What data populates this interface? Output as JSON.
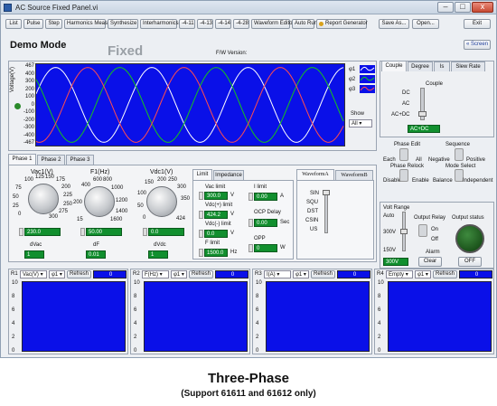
{
  "window": {
    "title": "AC Source Fixed Panel.vi",
    "min": "–",
    "max": "□",
    "close": "x"
  },
  "toolbar": {
    "items": [
      "List",
      "Pulse",
      "Step",
      "Harmonics Meas.",
      "Synthesize",
      "Interharmonics",
      "-4-11",
      "-4-13",
      "-4-14",
      "-4-28",
      "Waveform Editor",
      "Auto Run",
      "Report Generator"
    ],
    "save": "Save As...",
    "open": "Open...",
    "exit": "Exit"
  },
  "header": {
    "mode": "Demo Mode",
    "fixed": "Fixed",
    "fw": "F/W Version:",
    "screen": "Screen"
  },
  "graph": {
    "ylabel": "Voltage(V)",
    "yticks": [
      "467",
      "400",
      "300",
      "200",
      "100",
      "0",
      "-100",
      "-200",
      "-300",
      "-400",
      "-467"
    ],
    "phases": [
      "φ1",
      "φ2",
      "φ3"
    ],
    "show": "Show",
    "show_value": "All"
  },
  "coupling": {
    "tabs": [
      "Couple",
      "Degree",
      "Is",
      "Slew Rate"
    ],
    "title": "Couple",
    "opts": [
      "DC",
      "AC",
      "AC+DC"
    ],
    "value": "AC+DC"
  },
  "phase": {
    "edit": "Phase Edit",
    "each": "Each",
    "all": "All",
    "seq": "Sequence",
    "neg": "Negative",
    "pos": "Positive",
    "relock": "Phase Relock",
    "disable": "Disable",
    "enable": "Enable",
    "modesel": "Mode Select",
    "balance": "Balance",
    "indep": "Independent"
  },
  "phasetabs": [
    "Phase 1",
    "Phase 2",
    "Phase 3"
  ],
  "vac": {
    "label": "Vac1(V)",
    "ticks": [
      "100",
      "125",
      "150",
      "175",
      "200",
      "225",
      "250",
      "275",
      "300",
      "0",
      "25",
      "50",
      "75"
    ],
    "value": "230.0",
    "d_label": "dVac",
    "d_value": "1"
  },
  "freq": {
    "label": "F1(Hz)",
    "ticks": [
      "400",
      "600",
      "800",
      "1000",
      "1200",
      "1400",
      "1600",
      "15",
      "200"
    ],
    "value": "50.00",
    "d_label": "dF",
    "d_value": "0.01"
  },
  "vdc": {
    "label": "Vdc1(V)",
    "ticks": [
      "150",
      "200",
      "250",
      "300",
      "350",
      "424",
      "100",
      "50",
      "0"
    ],
    "value": "0.0",
    "d_label": "dVdc",
    "d_value": "1"
  },
  "limits": {
    "tabs": [
      "Limit",
      "Impedance"
    ],
    "vac_l": "Vac limit",
    "vac_v": "300.0",
    "vac_u": "V",
    "vpos_l": "Vdc(+) limit",
    "vpos_v": "424.2",
    "vpos_u": "V",
    "vneg_l": "Vdc(-) limit",
    "vneg_v": "0.0",
    "vneg_u": "V",
    "f_l": "F limit",
    "f_v": "1500.0",
    "f_u": "Hz",
    "i_l": "I limit",
    "i_v": "0.00",
    "i_u": "A",
    "ocp_l": "OCP Delay",
    "ocp_v": "0.00",
    "ocp_u": "Sec",
    "opp_l": "OPP",
    "opp_v": "0",
    "opp_u": "W"
  },
  "waveform": {
    "tabs": [
      "WaveformA",
      "WaveformB"
    ],
    "items": [
      "SIN",
      "SQU",
      "DST",
      "CSIN",
      "US"
    ]
  },
  "output": {
    "voltrange": "Volt Range",
    "auto": "Auto",
    "r300": "300V",
    "r150": "150V",
    "range_val": "300V",
    "relay": "Output Relay",
    "on": "On",
    "off": "Off",
    "status": "Output status",
    "statusval": "OFF",
    "alarm": "Alarm",
    "clear": "Clear"
  },
  "readouts": [
    {
      "id": "R1",
      "sel": "Vac(V)",
      "ph": "φ1",
      "refresh": "Refresh",
      "val": "0"
    },
    {
      "id": "R2",
      "sel": "F(Hz)",
      "ph": "φ1",
      "refresh": "Refresh",
      "val": "0"
    },
    {
      "id": "R3",
      "sel": "I(A)",
      "ph": "φ1",
      "refresh": "Refresh",
      "val": "0"
    },
    {
      "id": "R4",
      "sel": "Empty",
      "ph": "φ1",
      "refresh": "Refresh",
      "val": "0"
    }
  ],
  "readout_yticks": [
    "10",
    "8",
    "6",
    "4",
    "2",
    "0"
  ],
  "caption": {
    "title": "Three-Phase",
    "sub": "(Support 61611 and 61612 only)"
  }
}
